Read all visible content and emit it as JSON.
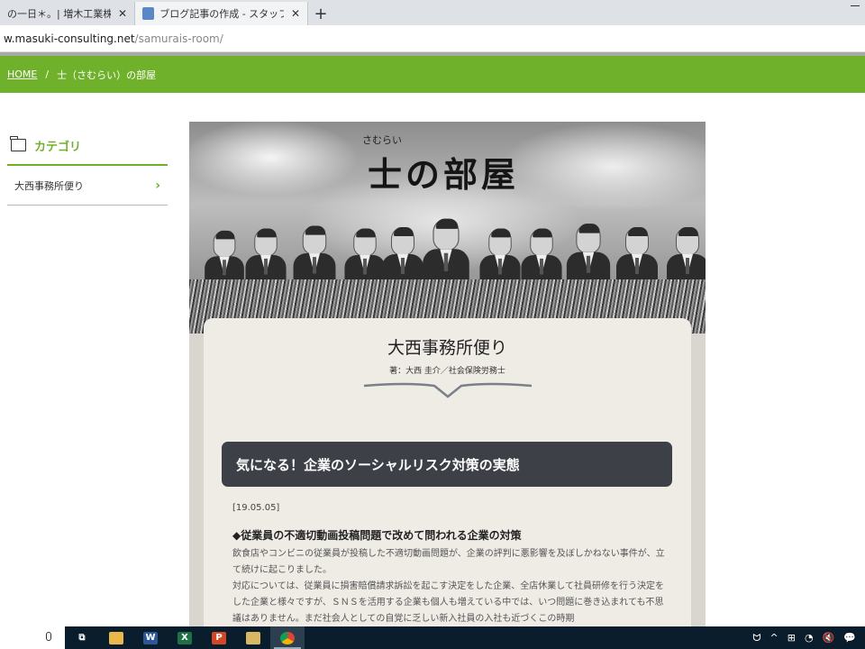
{
  "browser": {
    "tabs": [
      {
        "label": "の一日＊。| 増木工業株式会",
        "close": "✕"
      },
      {
        "label": "ブログ記事の作成 - スタッフ日記 | M",
        "close": "✕"
      }
    ],
    "new_tab": "+",
    "url_host": "w.masuki-consulting.net",
    "url_path": "/samurais-room/"
  },
  "breadcrumb": {
    "home": "HOME",
    "separator": "/",
    "current": "士（さむらい）の部屋"
  },
  "sidebar": {
    "title": "カテゴリ",
    "items": [
      {
        "label": "大西事務所便り",
        "chevron": "›"
      }
    ]
  },
  "banner": {
    "ruby": "さむらい",
    "title": "士の部屋"
  },
  "office": {
    "title": "大西事務所便り",
    "author": "著：大西 圭介／社会保険労務士"
  },
  "article": {
    "heading": "気になる！企業のソーシャルリスク対策の実態",
    "date": "[19.05.05]",
    "subheading": "◆従業員の不適切動画投稿問題で改めて問われる企業の対策",
    "paragraphs": [
      "飲食店やコンビニの従業員が投稿した不適切動画問題が、企業の評判に悪影響を及ぼしかねない事件が、立て続けに起こりました。",
      "対応については、従業員に損害賠償請求訴訟を起こす決定をした企業、全店休業して社員研修を行う決定をした企業と様々ですが、ＳＮＳを活用する企業も個人も増えている中では、いつ問題に巻き込まれても不思議はありません。まだ社会人としての自覚に乏しい新入社員の入社も近づくこの時期"
    ]
  },
  "taskbar": {
    "apps": [
      {
        "name": "task-view",
        "glyph": "⧉",
        "color": "#0a1d2d"
      },
      {
        "name": "file-explorer",
        "glyph": "",
        "color": "#e8b84a"
      },
      {
        "name": "word",
        "glyph": "W",
        "color": "#2b5797"
      },
      {
        "name": "excel",
        "glyph": "X",
        "color": "#1e7145"
      },
      {
        "name": "powerpoint",
        "glyph": "P",
        "color": "#d24726"
      },
      {
        "name": "explorer-2",
        "glyph": "",
        "color": "#d8b860"
      },
      {
        "name": "chrome",
        "glyph": "",
        "color": "#db4437"
      }
    ],
    "tray": [
      "ᗢ",
      "^",
      "⊞",
      "◔",
      "🔇",
      "💬"
    ]
  },
  "colors": {
    "accent_green": "#6fb12b",
    "article_header_bg": "#3d4047"
  }
}
